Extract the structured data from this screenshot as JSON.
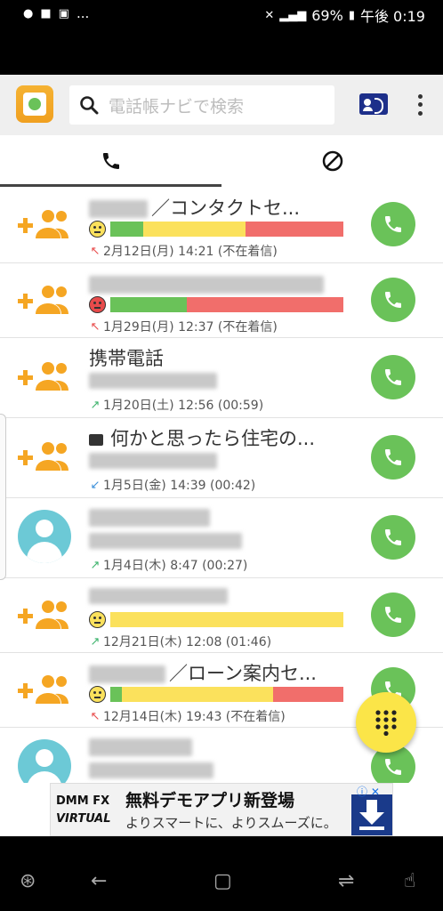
{
  "status": {
    "notif_icons": [
      "line-icon",
      "notification-icon",
      "voicemail-icon"
    ],
    "more": "...",
    "battery": "69%",
    "time": "午後 0:19"
  },
  "search": {
    "placeholder": "電話帳ナビで検索"
  },
  "tabs": [
    {
      "icon": "phone-icon"
    },
    {
      "icon": "block-icon"
    }
  ],
  "calls": [
    {
      "name_visible": "／コンタクトセ...",
      "detail": "2月12日(月) 14:21 (不在着信)",
      "type": "missed",
      "rating": "neutral",
      "bar": [
        0.14,
        0.44,
        0.42
      ]
    },
    {
      "name_visible": "",
      "detail": "1月29日(月) 12:37 (不在着信)",
      "type": "missed",
      "rating": "bad",
      "bar": [
        0.33,
        0.0,
        0.67
      ]
    },
    {
      "name_visible": "携帯電話",
      "detail": "1月20日(土) 12:56 (00:59)",
      "type": "outgoing"
    },
    {
      "name_visible": "何かと思ったら住宅の...",
      "detail": "1月5日(金) 14:39 (00:42)",
      "type": "incoming",
      "has_message": true
    },
    {
      "name_visible": "",
      "detail": "1月4日(木) 8:47 (00:27)",
      "type": "outgoing",
      "avatar": true
    },
    {
      "name_visible": "",
      "detail": "12月21日(木) 12:08 (01:46)",
      "type": "outgoing",
      "rating": "neutral",
      "bar": [
        0.0,
        1.0,
        0.0
      ]
    },
    {
      "name_visible": "／ローン案内セ...",
      "detail": "12月14日(木) 19:43 (不在着信)",
      "type": "missed",
      "rating": "neutral",
      "bar": [
        0.05,
        0.65,
        0.3
      ]
    },
    {
      "name_visible": "",
      "detail": "",
      "type": "outgoing",
      "avatar": true
    }
  ],
  "ad": {
    "brand_top": "DMM FX",
    "brand_bottom": "VIRTUAL",
    "title": "無料デモアプリ新登場",
    "subtitle": "よりスマートに、よりスムーズに。"
  },
  "colors": {
    "green": "#6ac259",
    "yellow": "#fbe15c",
    "red": "#f16e6b",
    "orange": "#f5a623"
  }
}
